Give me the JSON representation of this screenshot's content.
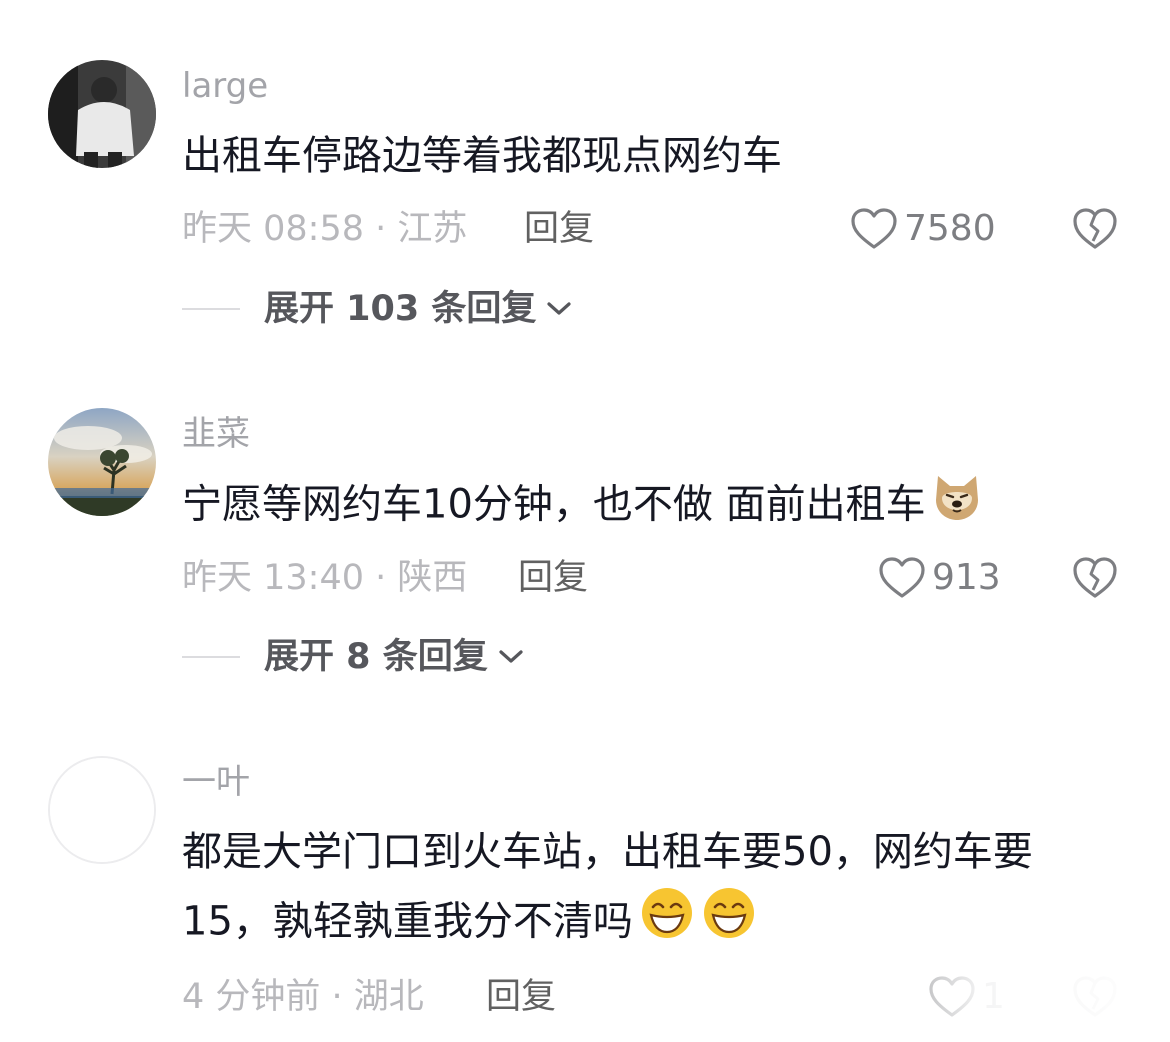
{
  "comments": [
    {
      "username": "large",
      "text": "出租车停路边等着我都现点网约车",
      "time_location": "昨天 08:58 · 江苏",
      "reply_label": "回复",
      "likes": "7580",
      "expand_label": "展开 103 条回复",
      "avatar_icon": "avatar-photo-person"
    },
    {
      "username": "韭菜",
      "text": "宁愿等网约车10分钟，也不做 面前出租车",
      "emoji": "doge-icon",
      "time_location": "昨天 13:40 · 陕西",
      "reply_label": "回复",
      "likes": "913",
      "expand_label": "展开 8 条回复",
      "avatar_icon": "avatar-photo-landscape"
    },
    {
      "username": "一叶",
      "text_line1": "都是大学门口到火车站，出租车要50，网约车要",
      "text_line2": "15，孰轻孰重我分不清吗",
      "emoji": "grin-icon",
      "time_location": "4 分钟前 · 湖北",
      "reply_label": "回复",
      "likes": "1",
      "avatar_icon": "avatar-blank"
    }
  ],
  "colors": {
    "username": "#a3a4a9",
    "text": "#161823",
    "meta": "#b8b8bc",
    "icon": "#7d7e82"
  }
}
